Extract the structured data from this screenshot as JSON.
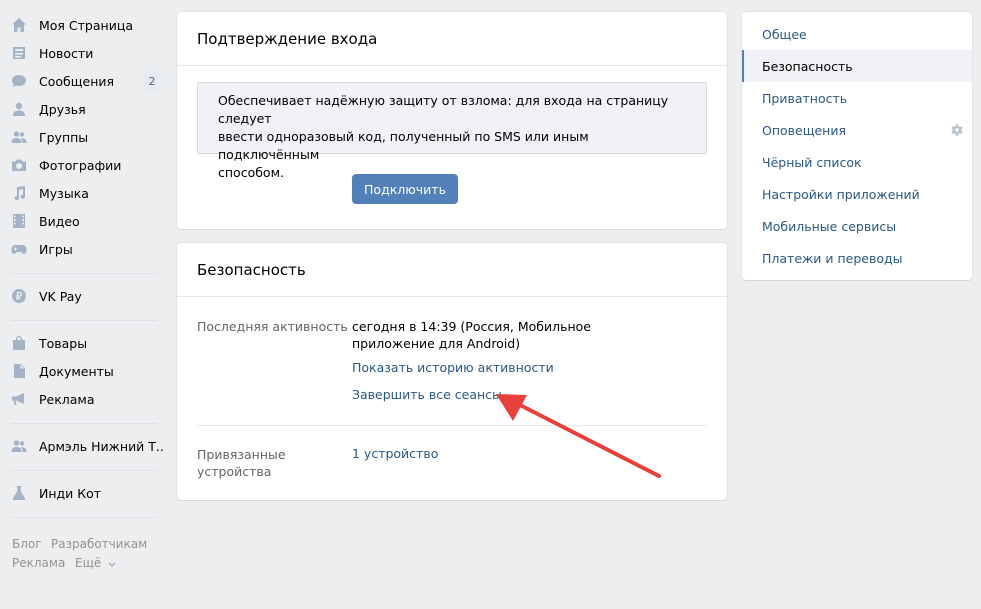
{
  "nav": {
    "items": [
      {
        "label": "Моя Страница",
        "icon": "home-icon"
      },
      {
        "label": "Новости",
        "icon": "news-icon"
      },
      {
        "label": "Сообщения",
        "icon": "messages-icon",
        "badge": "2"
      },
      {
        "label": "Друзья",
        "icon": "friends-icon"
      },
      {
        "label": "Группы",
        "icon": "groups-icon"
      },
      {
        "label": "Фотографии",
        "icon": "camera-icon"
      },
      {
        "label": "Музыка",
        "icon": "music-icon"
      },
      {
        "label": "Видео",
        "icon": "video-icon"
      },
      {
        "label": "Игры",
        "icon": "gamepad-icon"
      },
      {
        "label": "VK Pay",
        "icon": "vkpay-icon"
      },
      {
        "label": "Товары",
        "icon": "bag-icon"
      },
      {
        "label": "Документы",
        "icon": "document-icon"
      },
      {
        "label": "Реклама",
        "icon": "megaphone-icon"
      },
      {
        "label": "Армэль Нижний Т..",
        "icon": "group-icon"
      },
      {
        "label": "Инди Кот",
        "icon": "flask-icon"
      }
    ]
  },
  "footer": {
    "blog": "Блог",
    "developers": "Разработчикам",
    "ads": "Реклама",
    "more": "Ещё"
  },
  "login_confirmation": {
    "title": "Подтверждение входа",
    "info_line1": "Обеспечивает надёжную защиту от взлома: для входа на страницу следует",
    "info_line2": "ввести одноразовый код, полученный по SMS или иным подключённым",
    "info_line3": "способом.",
    "connect_button": "Подключить"
  },
  "security": {
    "title": "Безопасность",
    "last_activity_label": "Последняя активность",
    "last_activity_line1": "сегодня в 14:39 (Россия, Мобильное",
    "last_activity_line2": "приложение для Android)",
    "show_history_link": "Показать историю активности",
    "end_sessions_link": "Завершить все сеансы",
    "linked_devices_label_line1": "Привязанные",
    "linked_devices_label_line2": "устройства",
    "linked_devices_value": "1 устройство"
  },
  "settings_menu": {
    "items": [
      {
        "label": "Общее"
      },
      {
        "label": "Безопасность",
        "active": true
      },
      {
        "label": "Приватность"
      },
      {
        "label": "Оповещения"
      },
      {
        "label": "Чёрный список"
      },
      {
        "label": "Настройки приложений"
      },
      {
        "label": "Мобильные сервисы"
      },
      {
        "label": "Платежи и переводы"
      }
    ]
  },
  "colors": {
    "accent": "#5181b8",
    "link": "#2a5885",
    "annotation_arrow": "#e8413b"
  }
}
